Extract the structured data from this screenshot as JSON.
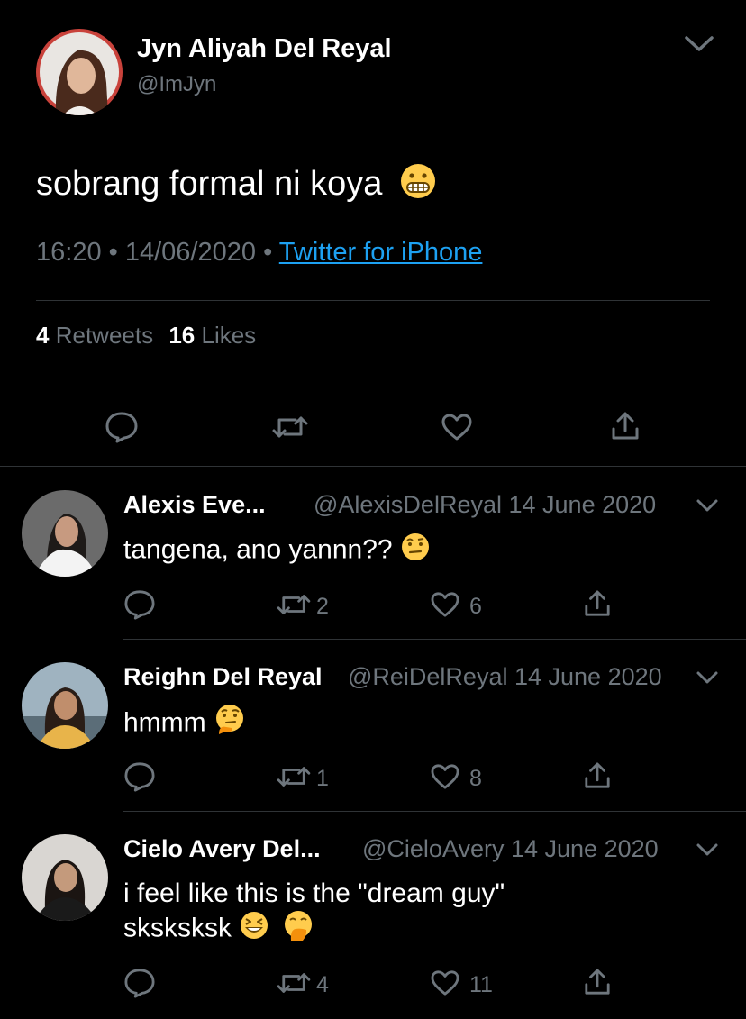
{
  "tweet": {
    "author_name": "Jyn Aliyah Del Reyal",
    "author_handle": "@ImJyn",
    "text": "sobrang formal ni koya",
    "time": "16:20",
    "date": "14/06/2020",
    "separator": "•",
    "source": "Twitter for iPhone",
    "retweets_count": "4",
    "retweets_label": "Retweets",
    "likes_count": "16",
    "likes_label": "Likes"
  },
  "replies": [
    {
      "name": "Alexis Eve...",
      "handle": "@AlexisDelReyal",
      "date": "14 June 2020",
      "text": "tangena, ano yannn??",
      "retweets": "2",
      "likes": "6"
    },
    {
      "name": "Reighn Del Reyal",
      "handle": "@ReiDelReyal",
      "date": "14 June 2020",
      "text": "hmmm",
      "retweets": "1",
      "likes": "8"
    },
    {
      "name": "Cielo Avery Del...",
      "handle": "@CieloAvery",
      "date": "14 June 2020",
      "text": "i feel like this is the \"dream guy\" sksksksk",
      "retweets": "4",
      "likes": "11"
    }
  ],
  "icons": {
    "reply": "reply-icon",
    "retweet": "retweet-icon",
    "like": "heart-icon",
    "share": "share-icon",
    "menu": "chevron-down-icon"
  },
  "colors": {
    "background": "#000000",
    "text": "#ffffff",
    "muted": "#6e767d",
    "link": "#1da1f2",
    "divider": "#2f3336"
  }
}
